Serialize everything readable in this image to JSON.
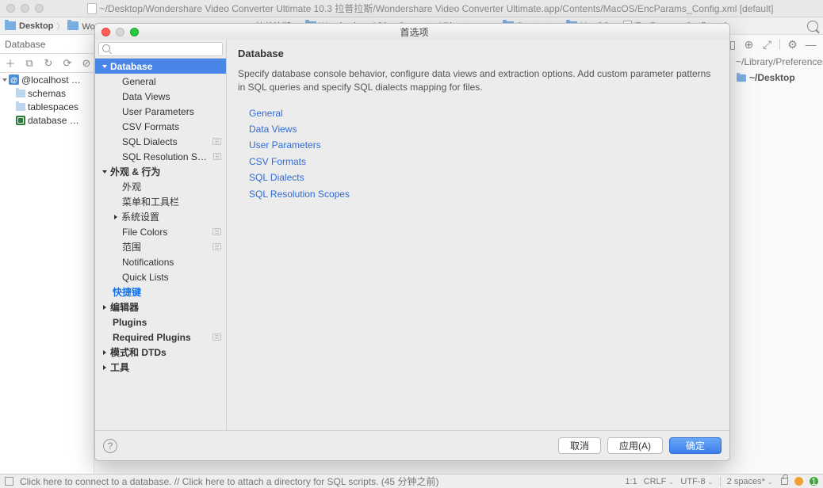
{
  "window": {
    "title": "~/Desktop/Wondershare Video Converter Ultimate 10.3 拉普拉斯/Wondershare Video Converter Ultimate.app/Contents/MacOS/EncParams_Config.xml [default]"
  },
  "breadcrumb": {
    "parts": [
      "Desktop",
      "Wondershare Video Converter Ultimate 10.3 拉普拉斯",
      "Wondershare Video Converter Ultimate.app",
      "Contents",
      "MacOS",
      "EncParams_Config.xml"
    ]
  },
  "sidebar_header": "Database",
  "db_tree": {
    "root": "@localhost …",
    "children": [
      "schemas",
      "tablespaces",
      "database …"
    ]
  },
  "recent": {
    "header": "~/Library/Preferences/D",
    "item": "~/Desktop"
  },
  "dialog": {
    "title": "首选项",
    "search_placeholder": "",
    "categories": {
      "database": {
        "label": "Database",
        "open": true,
        "children": [
          "General",
          "Data Views",
          "User Parameters",
          "CSV Formats",
          "SQL Dialects",
          "SQL Resolution Scopes"
        ]
      },
      "appearance": {
        "label": "外观 & 行为",
        "open": true,
        "children": [
          "外观",
          "菜单和工具栏",
          "系统设置",
          "File Colors",
          "范围",
          "Notifications",
          "Quick Lists"
        ]
      },
      "keymap": {
        "label": "快捷键"
      },
      "editor": {
        "label": "编辑器"
      },
      "plugins": {
        "label": "Plugins"
      },
      "required_plugins": {
        "label": "Required Plugins"
      },
      "schemas": {
        "label": "模式和 DTDs"
      },
      "tools": {
        "label": "工具"
      }
    },
    "content": {
      "heading": "Database",
      "description": "Specify database console behavior, configure data views and extraction options. Add custom parameter patterns in SQL queries and specify SQL dialects mapping for files.",
      "links": [
        "General",
        "Data Views",
        "User Parameters",
        "CSV Formats",
        "SQL Dialects",
        "SQL Resolution Scopes"
      ]
    },
    "buttons": {
      "cancel": "取消",
      "apply": "应用(A)",
      "ok": "确定"
    }
  },
  "status": {
    "message": "Click here to connect to a database. // Click here to attach a directory for SQL scripts. (45 分钟之前)",
    "pos": "1:1",
    "encoding_mode": "CRLF",
    "encoding": "UTF-8",
    "indent": "2 spaces*",
    "badge": "1"
  }
}
